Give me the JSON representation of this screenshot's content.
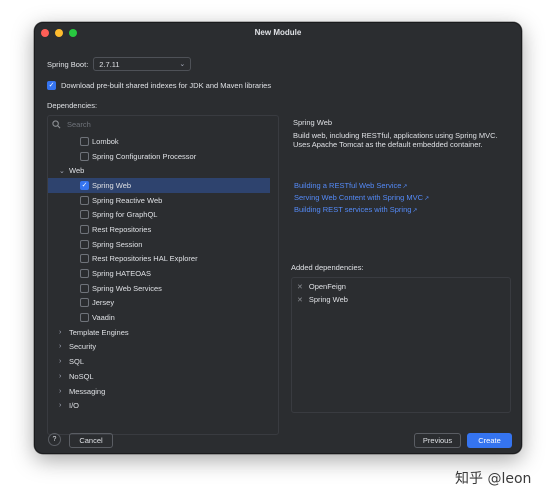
{
  "window": {
    "title": "New Module"
  },
  "spring_boot": {
    "label": "Spring Boot:",
    "value": "2.7.11"
  },
  "download_indexes": {
    "label": "Download pre-built shared indexes for JDK and Maven libraries",
    "checked": true
  },
  "dependencies_label": "Dependencies:",
  "search": {
    "placeholder": "Search"
  },
  "tree": {
    "items": [
      {
        "label": "Lombok"
      },
      {
        "label": "Spring Configuration Processor"
      },
      {
        "label": "Web"
      },
      {
        "label": "Spring Web"
      },
      {
        "label": "Spring Reactive Web"
      },
      {
        "label": "Spring for GraphQL"
      },
      {
        "label": "Rest Repositories"
      },
      {
        "label": "Spring Session"
      },
      {
        "label": "Rest Repositories HAL Explorer"
      },
      {
        "label": "Spring HATEOAS"
      },
      {
        "label": "Spring Web Services"
      },
      {
        "label": "Jersey"
      },
      {
        "label": "Vaadin"
      },
      {
        "label": "Template Engines"
      },
      {
        "label": "Security"
      },
      {
        "label": "SQL"
      },
      {
        "label": "NoSQL"
      },
      {
        "label": "Messaging"
      },
      {
        "label": "I/O"
      }
    ]
  },
  "info": {
    "title": "Spring Web",
    "description": "Build web, including RESTful, applications using Spring MVC. Uses Apache Tomcat as the default embedded container.",
    "links": [
      "Building a RESTful Web Service",
      "Serving Web Content with Spring MVC",
      "Building REST services with Spring"
    ]
  },
  "added": {
    "label": "Added dependencies:",
    "items": [
      "OpenFeign",
      "Spring Web"
    ]
  },
  "buttons": {
    "help": "?",
    "cancel": "Cancel",
    "previous": "Previous",
    "create": "Create"
  },
  "watermark": "知乎 @leon",
  "colors": {
    "accent": "#3574f0",
    "link": "#548af7",
    "background": "#2b2d30"
  }
}
